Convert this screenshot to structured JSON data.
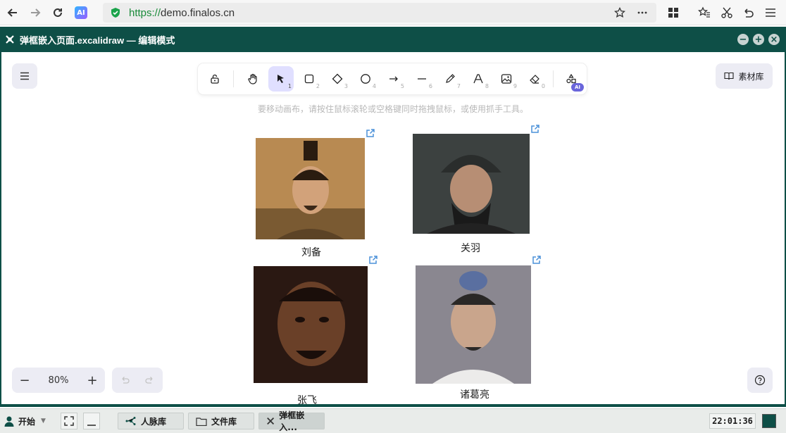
{
  "browser": {
    "url_scheme": "https://",
    "url_host": "demo.finalos.cn",
    "ai_badge": "AI"
  },
  "window": {
    "title": "弹框嵌入页面.excalidraw — 编辑模式"
  },
  "toolbar": {
    "tools": [
      {
        "name": "lock",
        "key": ""
      },
      {
        "name": "hand",
        "key": ""
      },
      {
        "name": "selection",
        "key": "1"
      },
      {
        "name": "rectangle",
        "key": "2"
      },
      {
        "name": "diamond",
        "key": "3"
      },
      {
        "name": "ellipse",
        "key": "4"
      },
      {
        "name": "arrow",
        "key": "5"
      },
      {
        "name": "line",
        "key": "6"
      },
      {
        "name": "pencil",
        "key": "7"
      },
      {
        "name": "text",
        "key": "8"
      },
      {
        "name": "image",
        "key": "9"
      },
      {
        "name": "eraser",
        "key": "0"
      }
    ],
    "ai_label": "AI",
    "library_label": "素材库"
  },
  "canvas": {
    "hint": "要移动画布，请按住鼠标滚轮或空格键同时拖拽鼠标，或使用抓手工具。",
    "cards": [
      {
        "caption": "刘备",
        "tone": "#b88a52"
      },
      {
        "caption": "关羽",
        "tone": "#4a4f4e"
      },
      {
        "caption": "张飞",
        "tone": "#3a2218"
      },
      {
        "caption": "诸葛亮",
        "tone": "#6b6a70"
      }
    ]
  },
  "footer": {
    "zoom": "80%",
    "zoom_out": "−",
    "zoom_in": "+"
  },
  "taskbar": {
    "start": "开始",
    "tasks": [
      "人脉库",
      "文件库",
      "弹框嵌入..."
    ],
    "clock": "22:01:36"
  },
  "colors": {
    "accent": "#0e4f47",
    "selected_tool": "#e0dfff",
    "url_green": "#1a8b3a"
  }
}
